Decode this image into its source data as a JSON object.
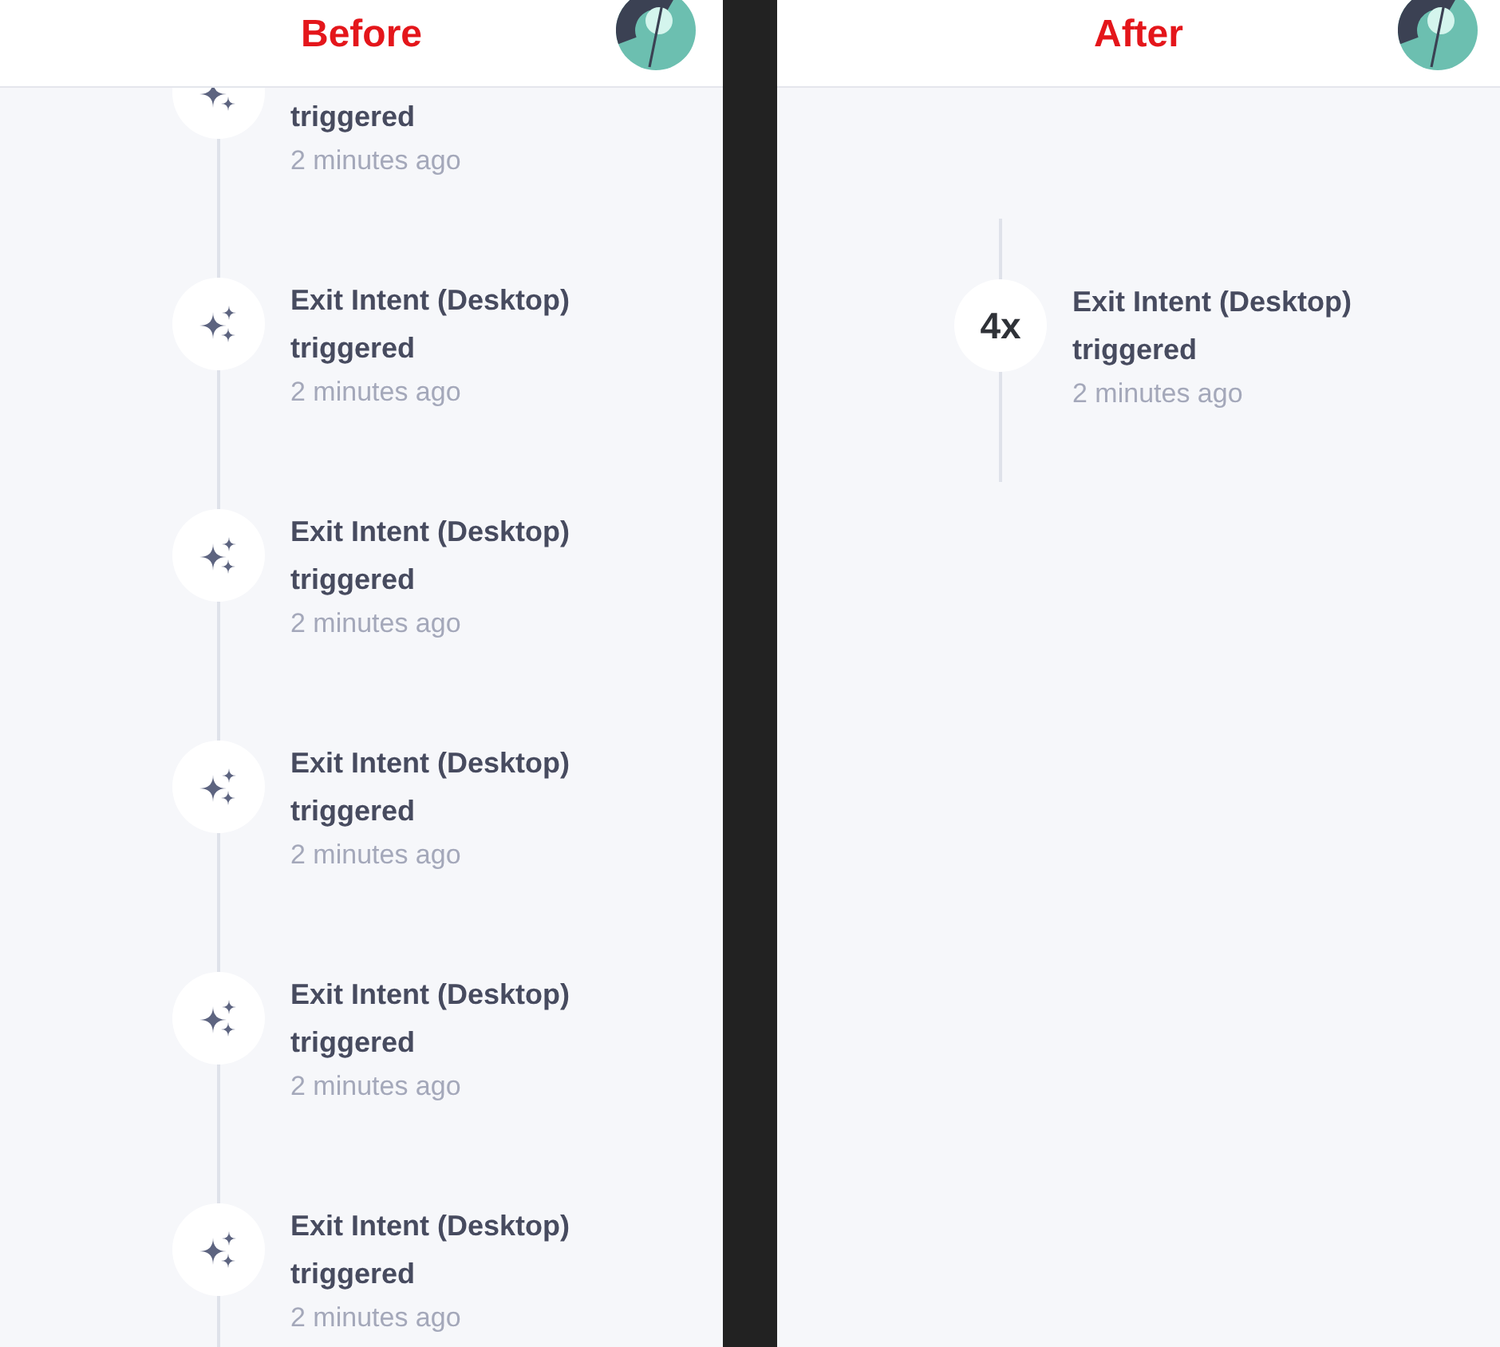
{
  "panels": [
    {
      "label": "Before",
      "events": [
        {
          "kind": "sparkle",
          "message": [
            "triggered"
          ],
          "time": "2 minutes ago"
        },
        {
          "kind": "sparkle",
          "message": [
            "Exit Intent (Desktop)",
            "triggered"
          ],
          "time": "2 minutes ago"
        },
        {
          "kind": "sparkle",
          "message": [
            "Exit Intent (Desktop)",
            "triggered"
          ],
          "time": "2 minutes ago"
        },
        {
          "kind": "sparkle",
          "message": [
            "Exit Intent (Desktop)",
            "triggered"
          ],
          "time": "2 minutes ago"
        },
        {
          "kind": "sparkle",
          "message": [
            "Exit Intent (Desktop)",
            "triggered"
          ],
          "time": "2 minutes ago"
        },
        {
          "kind": "sparkle",
          "message": [
            "Exit Intent (Desktop)",
            "triggered"
          ],
          "time": "2 minutes ago"
        }
      ]
    },
    {
      "label": "After",
      "events": [
        {
          "kind": "count",
          "count": "4x",
          "message": [
            "Exit Intent (Desktop)",
            "triggered"
          ],
          "time": "2 minutes ago"
        }
      ]
    }
  ]
}
